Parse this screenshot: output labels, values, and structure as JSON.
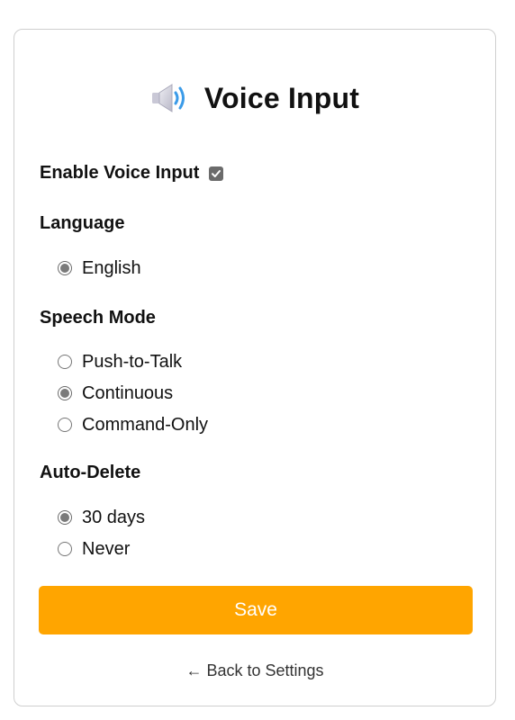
{
  "header": {
    "title": "Voice Input",
    "icon": "speaker-icon"
  },
  "enable_voice": {
    "label": "Enable Voice Input",
    "checked": true
  },
  "language": {
    "label": "Language",
    "options": [
      {
        "label": "English",
        "checked": true
      }
    ]
  },
  "speech_mode": {
    "label": "Speech Mode",
    "options": [
      {
        "label": "Push-to-Talk",
        "checked": false
      },
      {
        "label": "Continuous",
        "checked": true
      },
      {
        "label": "Command-Only",
        "checked": false
      }
    ]
  },
  "auto_delete": {
    "label": "Auto-Delete",
    "options": [
      {
        "label": "30 days",
        "checked": true
      },
      {
        "label": "Never",
        "checked": false
      }
    ]
  },
  "actions": {
    "save_label": "Save",
    "back_label": "← Back to Settings"
  },
  "colors": {
    "accent": "#ffa500",
    "speaker_wave": "#3b9be8"
  }
}
